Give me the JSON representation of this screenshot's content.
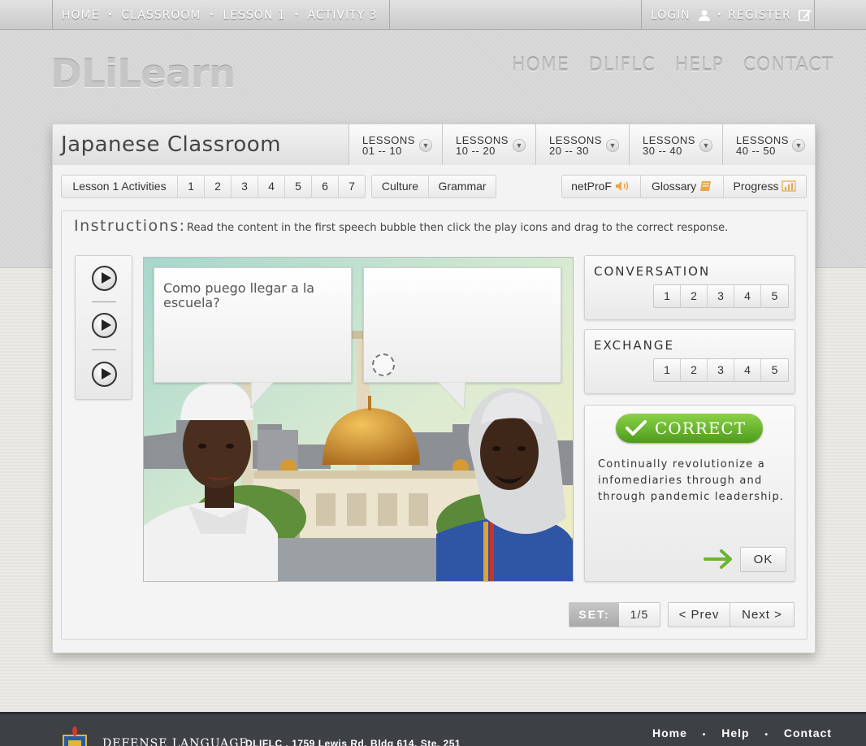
{
  "breadcrumb": {
    "items": [
      "HOME",
      "CLASSROOM",
      "LESSON 1",
      "ACTIVITY 3"
    ]
  },
  "account": {
    "login": "LOGIN",
    "register": "REGISTER"
  },
  "brand": {
    "logo": "DLiLearn"
  },
  "main_nav": [
    "HOME",
    "DLIFLC",
    "HELP",
    "CONTACT"
  ],
  "classroom": {
    "title": "Japanese Classroom",
    "lesson_tabs": [
      {
        "label": "LESSONS",
        "range": "01 -- 10"
      },
      {
        "label": "LESSONS",
        "range": "10 -- 20"
      },
      {
        "label": "LESSONS",
        "range": "20 -- 30"
      },
      {
        "label": "LESSONS",
        "range": "30 -- 40"
      },
      {
        "label": "LESSONS",
        "range": "40 -- 50"
      }
    ]
  },
  "subnav": {
    "activities_label": "Lesson 1 Activities",
    "activities": [
      "1",
      "2",
      "3",
      "4",
      "5",
      "6",
      "7"
    ],
    "culture": "Culture",
    "grammar": "Grammar",
    "netprof": "netProF",
    "glossary": "Glossary",
    "progress": "Progress"
  },
  "instructions": {
    "label": "Instructions:",
    "text": "Read the content in the first speech bubble then click the play icons and drag to the correct response."
  },
  "scene": {
    "bubble1_text": "Como puego llegar a la escuela?",
    "bubble2_text": ""
  },
  "conversation": {
    "title": "CONVERSATION",
    "items": [
      "1",
      "2",
      "3",
      "4",
      "5"
    ]
  },
  "exchange": {
    "title": "EXCHANGE",
    "items": [
      "1",
      "2",
      "3",
      "4",
      "5"
    ]
  },
  "feedback": {
    "badge": "CORRECT",
    "message": "Continually revolutionize a infomediaries through and through pandemic leadership.",
    "ok": "OK",
    "accent": "#6bb52f"
  },
  "pager": {
    "set_label": "SET:",
    "set_value": "1/5",
    "prev": "< Prev",
    "next": "Next >"
  },
  "footer": {
    "org": "DEFENSE LANGUAGE",
    "address": "DLIFLC . 1759 Lewis Rd. Bldg 614, Ste. 251",
    "links": [
      "Home",
      "Help",
      "Contact"
    ]
  },
  "icons": {
    "login": "user-icon",
    "register": "edit-icon",
    "netprof": "speaker-icon",
    "glossary": "book-icon",
    "progress": "bar-chart-icon"
  }
}
